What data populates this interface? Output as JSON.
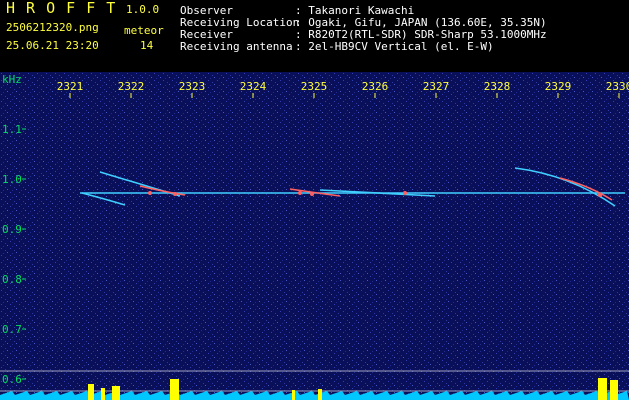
{
  "header": {
    "app_name": "H R O F F T",
    "version": "1.0.0",
    "filename": "2506212320.png",
    "meteor_label": "meteor",
    "datetime": "25.06.21 23:20",
    "meteor_count": "14",
    "info": [
      {
        "key": "Observer",
        "value": ": Takanori Kawachi"
      },
      {
        "key": "Receiving Location",
        "value": ": Ogaki, Gifu, JAPAN (136.60E, 35.35N)"
      },
      {
        "key": "Receiver",
        "value": ": R820T2(RTL-SDR) SDR-Sharp 53.1000MHz"
      },
      {
        "key": "Receiving antenna",
        "value": ": 2el-HB9CV Vertical (el. E-W)"
      }
    ]
  },
  "waterfall": {
    "y_unit": "kHz",
    "y_ticks": [
      "1.1",
      "1.0",
      "0.9",
      "0.8",
      "0.7",
      "0.6"
    ],
    "time_ticks": [
      "2321",
      "2322",
      "2323",
      "2324",
      "2325",
      "2326",
      "2327",
      "2328",
      "2329",
      "2330"
    ],
    "colors": {
      "background": "#0a0f5a",
      "carrier": "#40d0ff",
      "meteor": "#ff6060",
      "text": "#ffff40",
      "label": "#00e060",
      "level": "#00c8ff",
      "burst": "#ffff00"
    }
  }
}
